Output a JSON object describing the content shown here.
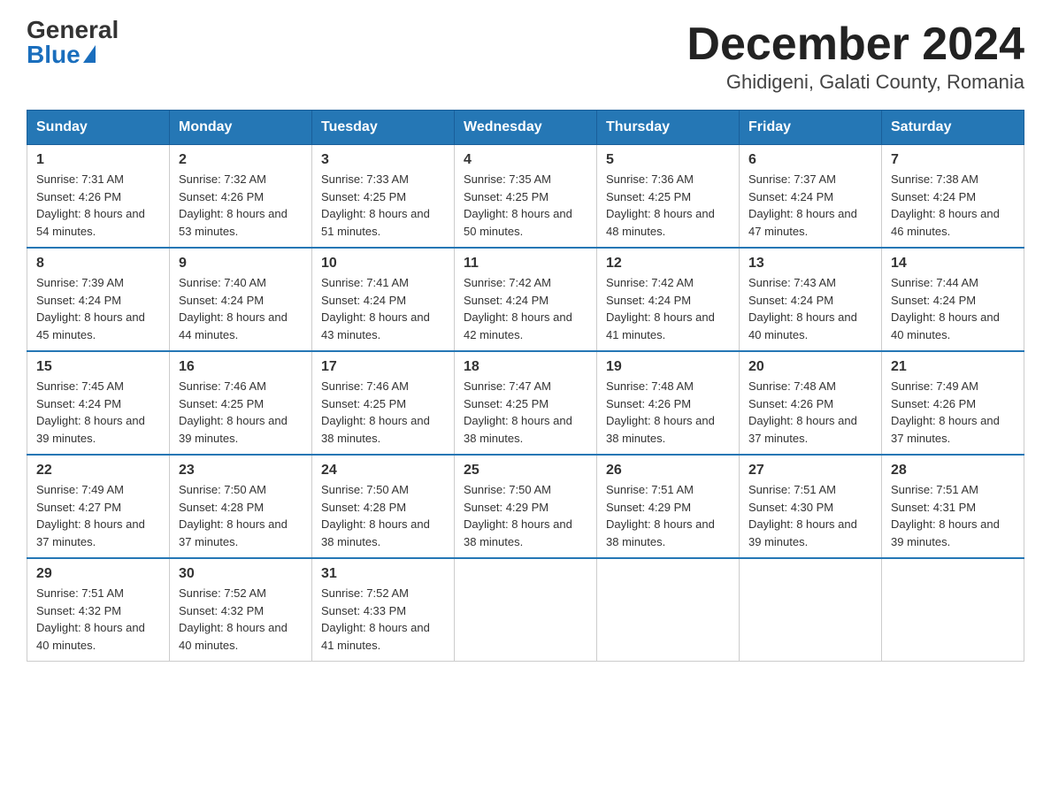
{
  "header": {
    "logo_general": "General",
    "logo_blue": "Blue",
    "title": "December 2024",
    "subtitle": "Ghidigeni, Galati County, Romania"
  },
  "days_of_week": [
    "Sunday",
    "Monday",
    "Tuesday",
    "Wednesday",
    "Thursday",
    "Friday",
    "Saturday"
  ],
  "weeks": [
    [
      {
        "day": "1",
        "sunrise": "7:31 AM",
        "sunset": "4:26 PM",
        "daylight": "8 hours and 54 minutes."
      },
      {
        "day": "2",
        "sunrise": "7:32 AM",
        "sunset": "4:26 PM",
        "daylight": "8 hours and 53 minutes."
      },
      {
        "day": "3",
        "sunrise": "7:33 AM",
        "sunset": "4:25 PM",
        "daylight": "8 hours and 51 minutes."
      },
      {
        "day": "4",
        "sunrise": "7:35 AM",
        "sunset": "4:25 PM",
        "daylight": "8 hours and 50 minutes."
      },
      {
        "day": "5",
        "sunrise": "7:36 AM",
        "sunset": "4:25 PM",
        "daylight": "8 hours and 48 minutes."
      },
      {
        "day": "6",
        "sunrise": "7:37 AM",
        "sunset": "4:24 PM",
        "daylight": "8 hours and 47 minutes."
      },
      {
        "day": "7",
        "sunrise": "7:38 AM",
        "sunset": "4:24 PM",
        "daylight": "8 hours and 46 minutes."
      }
    ],
    [
      {
        "day": "8",
        "sunrise": "7:39 AM",
        "sunset": "4:24 PM",
        "daylight": "8 hours and 45 minutes."
      },
      {
        "day": "9",
        "sunrise": "7:40 AM",
        "sunset": "4:24 PM",
        "daylight": "8 hours and 44 minutes."
      },
      {
        "day": "10",
        "sunrise": "7:41 AM",
        "sunset": "4:24 PM",
        "daylight": "8 hours and 43 minutes."
      },
      {
        "day": "11",
        "sunrise": "7:42 AM",
        "sunset": "4:24 PM",
        "daylight": "8 hours and 42 minutes."
      },
      {
        "day": "12",
        "sunrise": "7:42 AM",
        "sunset": "4:24 PM",
        "daylight": "8 hours and 41 minutes."
      },
      {
        "day": "13",
        "sunrise": "7:43 AM",
        "sunset": "4:24 PM",
        "daylight": "8 hours and 40 minutes."
      },
      {
        "day": "14",
        "sunrise": "7:44 AM",
        "sunset": "4:24 PM",
        "daylight": "8 hours and 40 minutes."
      }
    ],
    [
      {
        "day": "15",
        "sunrise": "7:45 AM",
        "sunset": "4:24 PM",
        "daylight": "8 hours and 39 minutes."
      },
      {
        "day": "16",
        "sunrise": "7:46 AM",
        "sunset": "4:25 PM",
        "daylight": "8 hours and 39 minutes."
      },
      {
        "day": "17",
        "sunrise": "7:46 AM",
        "sunset": "4:25 PM",
        "daylight": "8 hours and 38 minutes."
      },
      {
        "day": "18",
        "sunrise": "7:47 AM",
        "sunset": "4:25 PM",
        "daylight": "8 hours and 38 minutes."
      },
      {
        "day": "19",
        "sunrise": "7:48 AM",
        "sunset": "4:26 PM",
        "daylight": "8 hours and 38 minutes."
      },
      {
        "day": "20",
        "sunrise": "7:48 AM",
        "sunset": "4:26 PM",
        "daylight": "8 hours and 37 minutes."
      },
      {
        "day": "21",
        "sunrise": "7:49 AM",
        "sunset": "4:26 PM",
        "daylight": "8 hours and 37 minutes."
      }
    ],
    [
      {
        "day": "22",
        "sunrise": "7:49 AM",
        "sunset": "4:27 PM",
        "daylight": "8 hours and 37 minutes."
      },
      {
        "day": "23",
        "sunrise": "7:50 AM",
        "sunset": "4:28 PM",
        "daylight": "8 hours and 37 minutes."
      },
      {
        "day": "24",
        "sunrise": "7:50 AM",
        "sunset": "4:28 PM",
        "daylight": "8 hours and 38 minutes."
      },
      {
        "day": "25",
        "sunrise": "7:50 AM",
        "sunset": "4:29 PM",
        "daylight": "8 hours and 38 minutes."
      },
      {
        "day": "26",
        "sunrise": "7:51 AM",
        "sunset": "4:29 PM",
        "daylight": "8 hours and 38 minutes."
      },
      {
        "day": "27",
        "sunrise": "7:51 AM",
        "sunset": "4:30 PM",
        "daylight": "8 hours and 39 minutes."
      },
      {
        "day": "28",
        "sunrise": "7:51 AM",
        "sunset": "4:31 PM",
        "daylight": "8 hours and 39 minutes."
      }
    ],
    [
      {
        "day": "29",
        "sunrise": "7:51 AM",
        "sunset": "4:32 PM",
        "daylight": "8 hours and 40 minutes."
      },
      {
        "day": "30",
        "sunrise": "7:52 AM",
        "sunset": "4:32 PM",
        "daylight": "8 hours and 40 minutes."
      },
      {
        "day": "31",
        "sunrise": "7:52 AM",
        "sunset": "4:33 PM",
        "daylight": "8 hours and 41 minutes."
      },
      null,
      null,
      null,
      null
    ]
  ],
  "labels": {
    "sunrise": "Sunrise:",
    "sunset": "Sunset:",
    "daylight": "Daylight:"
  }
}
